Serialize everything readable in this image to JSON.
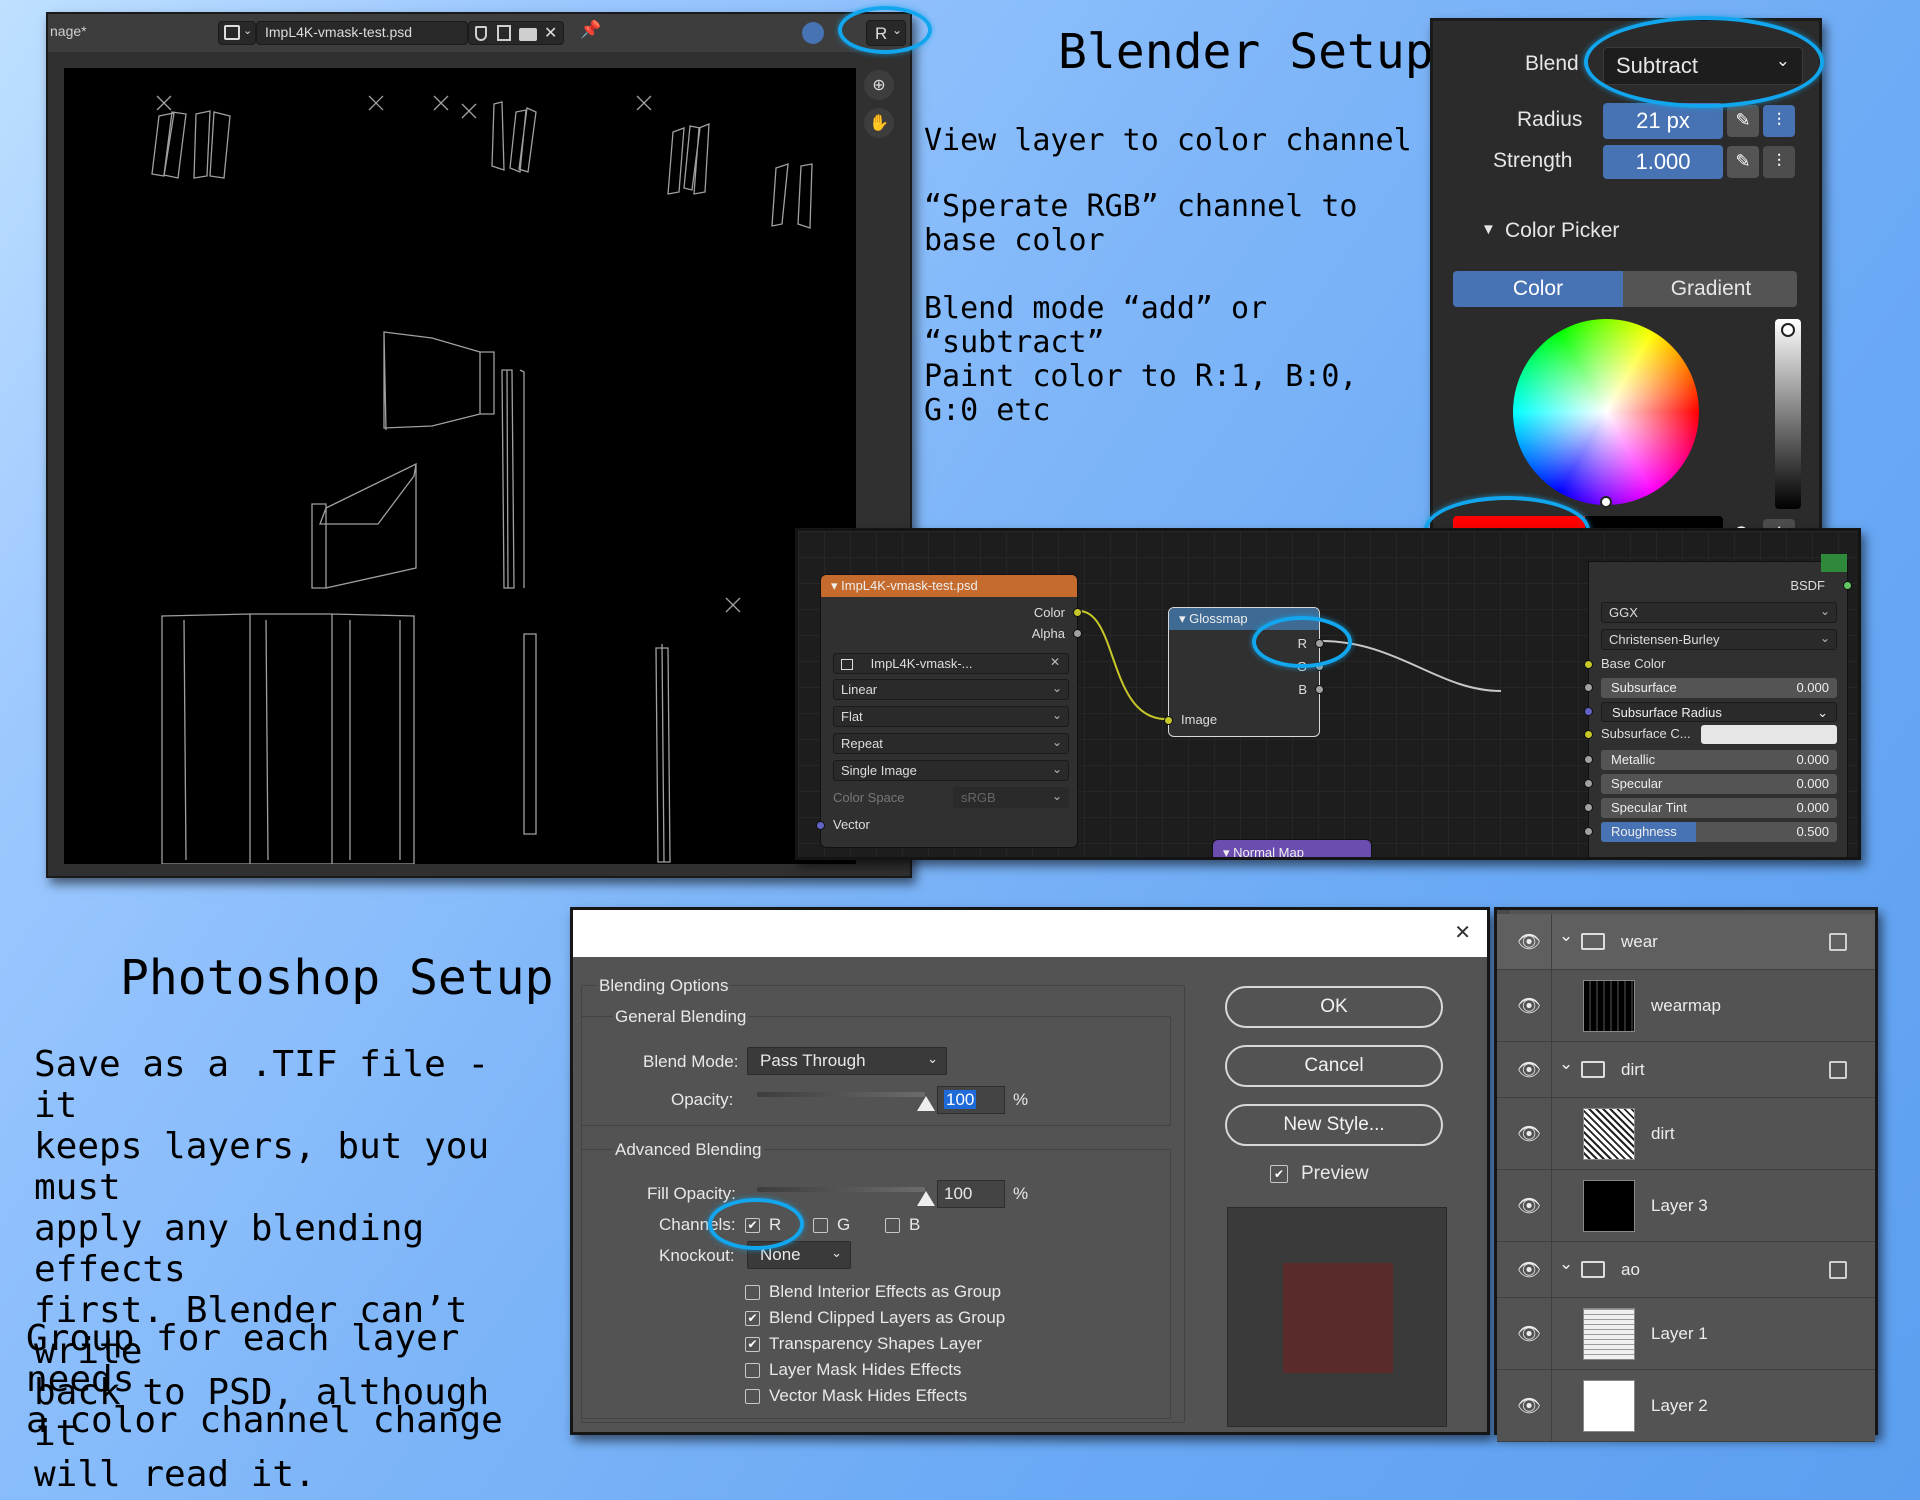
{
  "colors": {
    "highlight_ring": "#12a6ee",
    "blender_blue": "#4772b3",
    "paint_red": "#ff0000",
    "image_node_header": "#c46b2d",
    "node_header": "#3f6a93",
    "normal_map_header": "#6b4db0",
    "ps_preview_swatch": "#5b2a2a"
  },
  "image_editor": {
    "tab_title": "nage*",
    "image_name": "ImpL4K-vmask-test.psd",
    "channel_selector": "R",
    "icons": [
      "image-type-icon",
      "fake-user-shield-icon",
      "duplicate-icon",
      "folder-icon",
      "close-icon",
      "pin-icon",
      "overlay-icon",
      "zoom-icon",
      "hand-pan-icon"
    ]
  },
  "blender_notes": {
    "title": "Blender Setup",
    "lines": [
      "View layer to color channel",
      "“Sperate RGB” channel to base color",
      "Blend mode “add” or “subtract”",
      "Paint color to R:1, B:0, G:0 etc"
    ]
  },
  "brush_popover": {
    "blend_label": "Blend",
    "blend_value": "Subtract",
    "radius_label": "Radius",
    "radius_value": "21 px",
    "strength_label": "Strength",
    "strength_value": "1.000",
    "color_picker_label": "Color Picker",
    "tab_color": "Color",
    "tab_gradient": "Gradient",
    "brightness_fraction": 1.0,
    "swatch_color": "#ff0000"
  },
  "node_editor": {
    "image_node": {
      "title": "ImpL4K-vmask-test.psd",
      "out_color": "Color",
      "out_alpha": "Alpha",
      "image_name": "ImpL4K-vmask-...",
      "interpolation": "Linear",
      "projection": "Flat",
      "extension": "Repeat",
      "source": "Single Image",
      "color_space_label": "Color Space",
      "color_space_value": "sRGB",
      "vector_label": "Vector"
    },
    "separate_node": {
      "title": "Glossmap",
      "out_r": "R",
      "out_g": "G",
      "out_b": "B",
      "in_image": "Image"
    },
    "normal_map_node": {
      "title": "Normal Map"
    },
    "bsdf": {
      "output_label": "BSDF",
      "distribution": "GGX",
      "subsurface_method": "Christensen-Burley",
      "base_color_label": "Base Color",
      "rows": [
        {
          "label": "Subsurface",
          "value": "0.000"
        },
        {
          "label": "Subsurface Radius",
          "value": ""
        },
        {
          "label": "Subsurface C...",
          "value": ""
        },
        {
          "label": "Metallic",
          "value": "0.000"
        },
        {
          "label": "Specular",
          "value": "0.000"
        },
        {
          "label": "Specular Tint",
          "value": "0.000"
        },
        {
          "label": "Roughness",
          "value": "0.500"
        }
      ],
      "roughness_fraction": 0.5
    }
  },
  "photoshop_notes": {
    "title": "Photoshop Setup",
    "para1_lines": [
      "Save as a .TIF file - it",
      "keeps layers, but you must",
      "apply any blending effects",
      "first.  Blender can’t write",
      "back to PSD, although it",
      "will read it."
    ],
    "para2_lines": [
      "Group for each layer needs",
      "a color channel change"
    ]
  },
  "ps_dialog": {
    "close_glyph": "✕",
    "blending_options": "Blending Options",
    "general_blending": "General Blending",
    "blend_mode_label": "Blend Mode:",
    "blend_mode_value": "Pass Through",
    "opacity_label": "Opacity:",
    "opacity_value": "100",
    "percent": "%",
    "advanced_blending": "Advanced Blending",
    "fill_opacity_label": "Fill Opacity:",
    "fill_opacity_value": "100",
    "channels_label": "Channels:",
    "channel_r": "R",
    "channel_g": "G",
    "channel_b": "B",
    "channel_r_checked": true,
    "channel_g_checked": false,
    "channel_b_checked": false,
    "knockout_label": "Knockout:",
    "knockout_value": "None",
    "options": [
      {
        "label": "Blend Interior Effects as Group",
        "checked": false
      },
      {
        "label": "Blend Clipped Layers as Group",
        "checked": true
      },
      {
        "label": "Transparency Shapes Layer",
        "checked": true
      },
      {
        "label": "Layer Mask Hides Effects",
        "checked": false
      },
      {
        "label": "Vector Mask Hides Effects",
        "checked": false
      }
    ],
    "ok": "OK",
    "cancel": "Cancel",
    "new_style": "New Style...",
    "preview_label": "Preview",
    "preview_checked": true
  },
  "layers_panel": {
    "rows": [
      {
        "name": "wear",
        "type": "group"
      },
      {
        "name": "wearmap",
        "type": "layer",
        "thumb": "dark-pattern"
      },
      {
        "name": "dirt",
        "type": "group"
      },
      {
        "name": "dirt",
        "type": "layer",
        "thumb": "noise-pattern"
      },
      {
        "name": "Layer 3",
        "type": "layer",
        "thumb": "black"
      },
      {
        "name": "ao",
        "type": "group"
      },
      {
        "name": "Layer 1",
        "type": "layer",
        "thumb": "light-pattern"
      },
      {
        "name": "Layer 2",
        "type": "layer",
        "thumb": "white"
      }
    ]
  }
}
